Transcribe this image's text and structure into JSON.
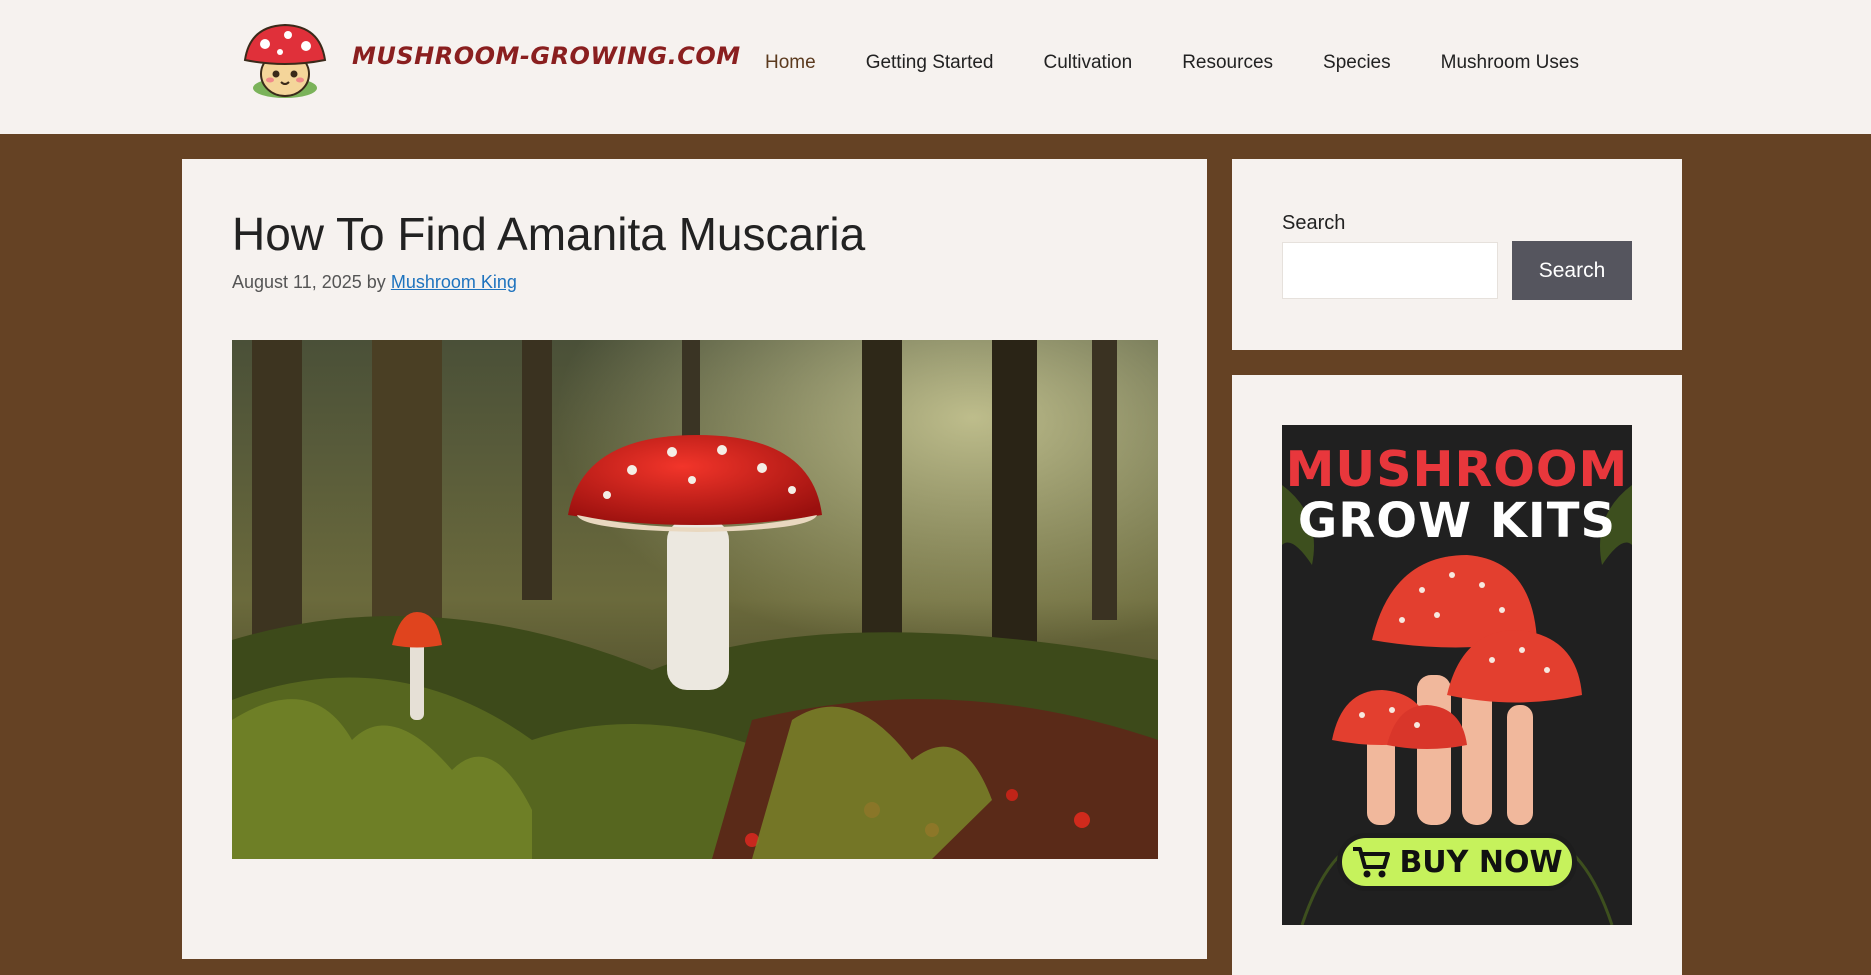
{
  "site": {
    "title": "MUSHROOM-GROWING.COM",
    "logo_icon": "mushroom-mascot-icon"
  },
  "nav": {
    "items": [
      {
        "label": "Home",
        "current": true
      },
      {
        "label": "Getting Started"
      },
      {
        "label": "Cultivation"
      },
      {
        "label": "Resources"
      },
      {
        "label": "Species"
      },
      {
        "label": "Mushroom Uses"
      }
    ]
  },
  "article": {
    "title": "How To Find Amanita Muscaria",
    "date": "August 11, 2025",
    "by": "by",
    "author": "Mushroom King"
  },
  "sidebar": {
    "search": {
      "label": "Search",
      "button": "Search",
      "value": "",
      "placeholder": ""
    },
    "ad": {
      "line1": "MUSHROOM",
      "line2": "GROW KITS",
      "cta": "BUY NOW",
      "cta_icon": "cart-icon"
    }
  },
  "colors": {
    "background": "#654224",
    "panel": "#f6f2ef",
    "accent_red": "#e8373c",
    "link": "#1e73be",
    "cta_green": "#c6f25c"
  }
}
